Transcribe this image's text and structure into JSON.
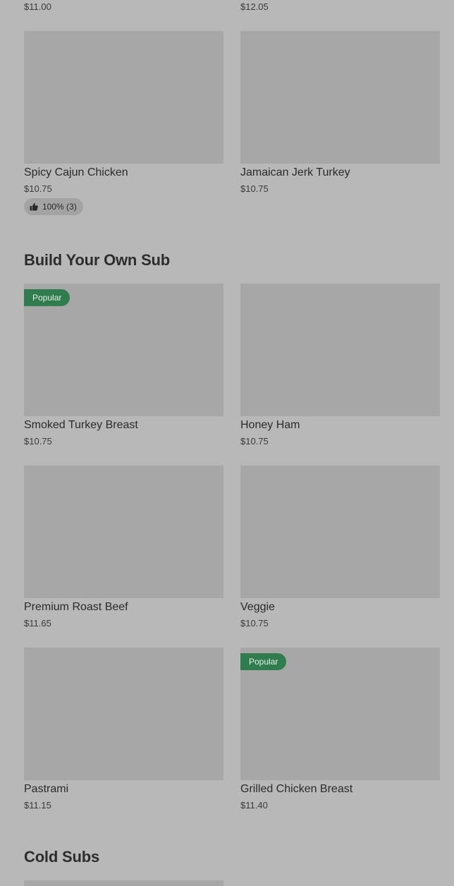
{
  "top_row": {
    "left_price": "$11.00",
    "right_price": "$12.05"
  },
  "row1": [
    {
      "name": "Spicy Cajun Chicken",
      "price": "$10.75",
      "rating": "100% (3)"
    },
    {
      "name": "Jamaican Jerk Turkey",
      "price": "$10.75"
    }
  ],
  "sections": {
    "build_your_own": "Build Your Own Sub",
    "cold_subs": "Cold Subs"
  },
  "badges": {
    "popular": "Popular"
  },
  "build_items": [
    {
      "name": "Smoked Turkey Breast",
      "price": "$10.75"
    },
    {
      "name": "Honey Ham",
      "price": "$10.75"
    },
    {
      "name": "Premium Roast Beef",
      "price": "$11.65"
    },
    {
      "name": "Veggie",
      "price": "$10.75"
    },
    {
      "name": "Pastrami",
      "price": "$11.15"
    },
    {
      "name": "Grilled Chicken Breast",
      "price": "$11.40"
    }
  ],
  "icons": {
    "rating": "thumbs-up-icon"
  }
}
